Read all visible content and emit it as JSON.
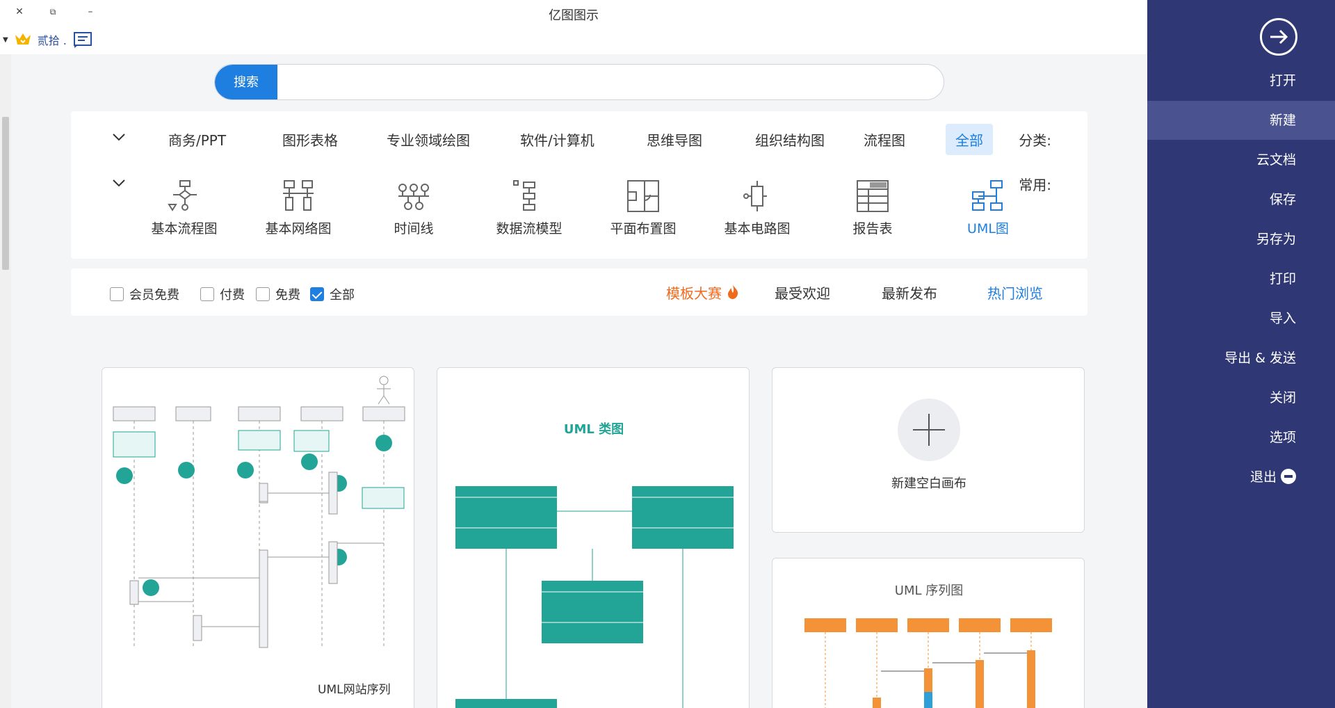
{
  "window": {
    "title": "亿图图示",
    "close_glyph": "✕",
    "restore_glyph": "⧉",
    "minimize_glyph": "–"
  },
  "user": {
    "name": "贰拾 .",
    "badge_color": "#f5b400"
  },
  "search": {
    "button_label": "搜索",
    "value": ""
  },
  "category": {
    "label": "分类:",
    "items": [
      "全部",
      "流程图",
      "组织结构图",
      "思维导图",
      "软件/计算机",
      "专业领域绘图",
      "图形表格",
      "商务/PPT"
    ],
    "active_index": 0
  },
  "common": {
    "label": "常用:",
    "items": [
      {
        "label": "UML图",
        "icon": "uml-icon"
      },
      {
        "label": "报告表",
        "icon": "report-icon"
      },
      {
        "label": "基本电路图",
        "icon": "circuit-icon"
      },
      {
        "label": "平面布置图",
        "icon": "floorplan-icon"
      },
      {
        "label": "数据流模型",
        "icon": "dataflow-icon"
      },
      {
        "label": "时间线",
        "icon": "timeline-icon"
      },
      {
        "label": "基本网络图",
        "icon": "network-icon"
      },
      {
        "label": "基本流程图",
        "icon": "flowchart-icon"
      }
    ],
    "active_index": 0
  },
  "tabs": {
    "items": [
      "热门浏览",
      "最新发布",
      "最受欢迎",
      "模板大赛"
    ],
    "active_index": 0
  },
  "price_filter": {
    "items": [
      "全部",
      "免费",
      "付费",
      "会员免费"
    ],
    "checked_index": 0
  },
  "cards": {
    "new_blank": "新建空白画布",
    "uml_sequence_title": "UML 序列图",
    "uml_class_title": "UML 类图",
    "uml_site_seq_caption": "UML网站序列"
  },
  "sidebar": {
    "items": [
      "打开",
      "新建",
      "云文档",
      "保存",
      "另存为",
      "打印",
      "导入",
      "导出 & 发送",
      "关闭",
      "选项",
      "退出"
    ],
    "active_index": 1
  },
  "colors": {
    "accent": "#1e7fe0",
    "sidebar_bg": "#2f3775",
    "sidebar_active": "#4a5290",
    "teal": "#22a596",
    "orange": "#f39236",
    "contest": "#f06a1e"
  }
}
